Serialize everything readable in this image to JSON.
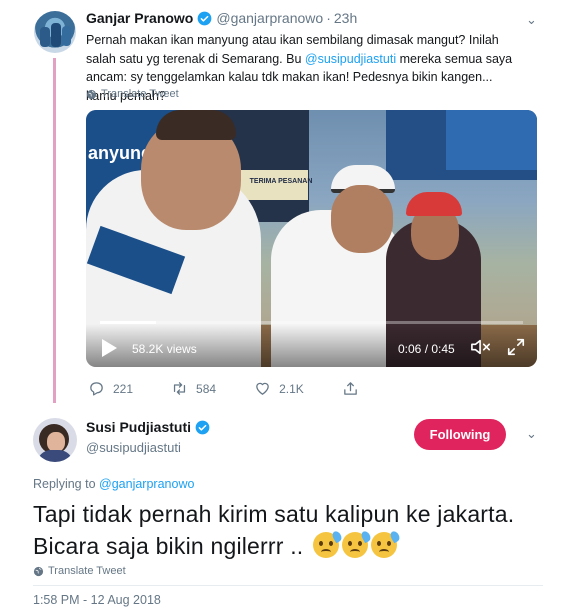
{
  "parent_tweet": {
    "name": "Ganjar Pranowo",
    "handle": "@ganjarpranowo",
    "separator": "·",
    "time": "23h",
    "text_before": "Pernah makan ikan manyung atau ikan sembilang dimasak mangut? Inilah salah satu yg terenak di Semarang. Bu ",
    "mention": "@susipudjiastuti",
    "text_after": " mereka semua saya ancam: sy tenggelamkan kalau tdk makan ikan! Pedesnya bikin kangen... kamu pernah?",
    "translate_label": "Translate Tweet",
    "video": {
      "banner_text": "manyung",
      "banner_text2": "anyung",
      "sign_text": "TERIMA PESANAN",
      "views": "58.2K views",
      "time": "0:06 / 0:45",
      "progress": 0.133
    },
    "actions": {
      "replies": "221",
      "retweets": "584",
      "likes": "2.1K"
    }
  },
  "main_tweet": {
    "name": "Susi Pudjiastuti",
    "handle": "@susipudjiastuti",
    "follow_label": "Following",
    "replying_prefix": "Replying to",
    "replying_to": "@ganjarpranowo",
    "text": "Tapi tidak pernah kirim satu kalipun ke jakarta. Bicara saja bikin ngilerrr .. ",
    "emojis": [
      "anxious-face-with-sweat",
      "anxious-face-with-sweat",
      "anxious-face-with-sweat"
    ],
    "translate_label": "Translate Tweet",
    "datetime": "1:58 PM - 12 Aug 2018"
  },
  "colors": {
    "accent_blue": "#1da1f2",
    "follow_button": "#e0245e",
    "thread_line": "#e2a0c2",
    "muted_text": "#657786"
  }
}
